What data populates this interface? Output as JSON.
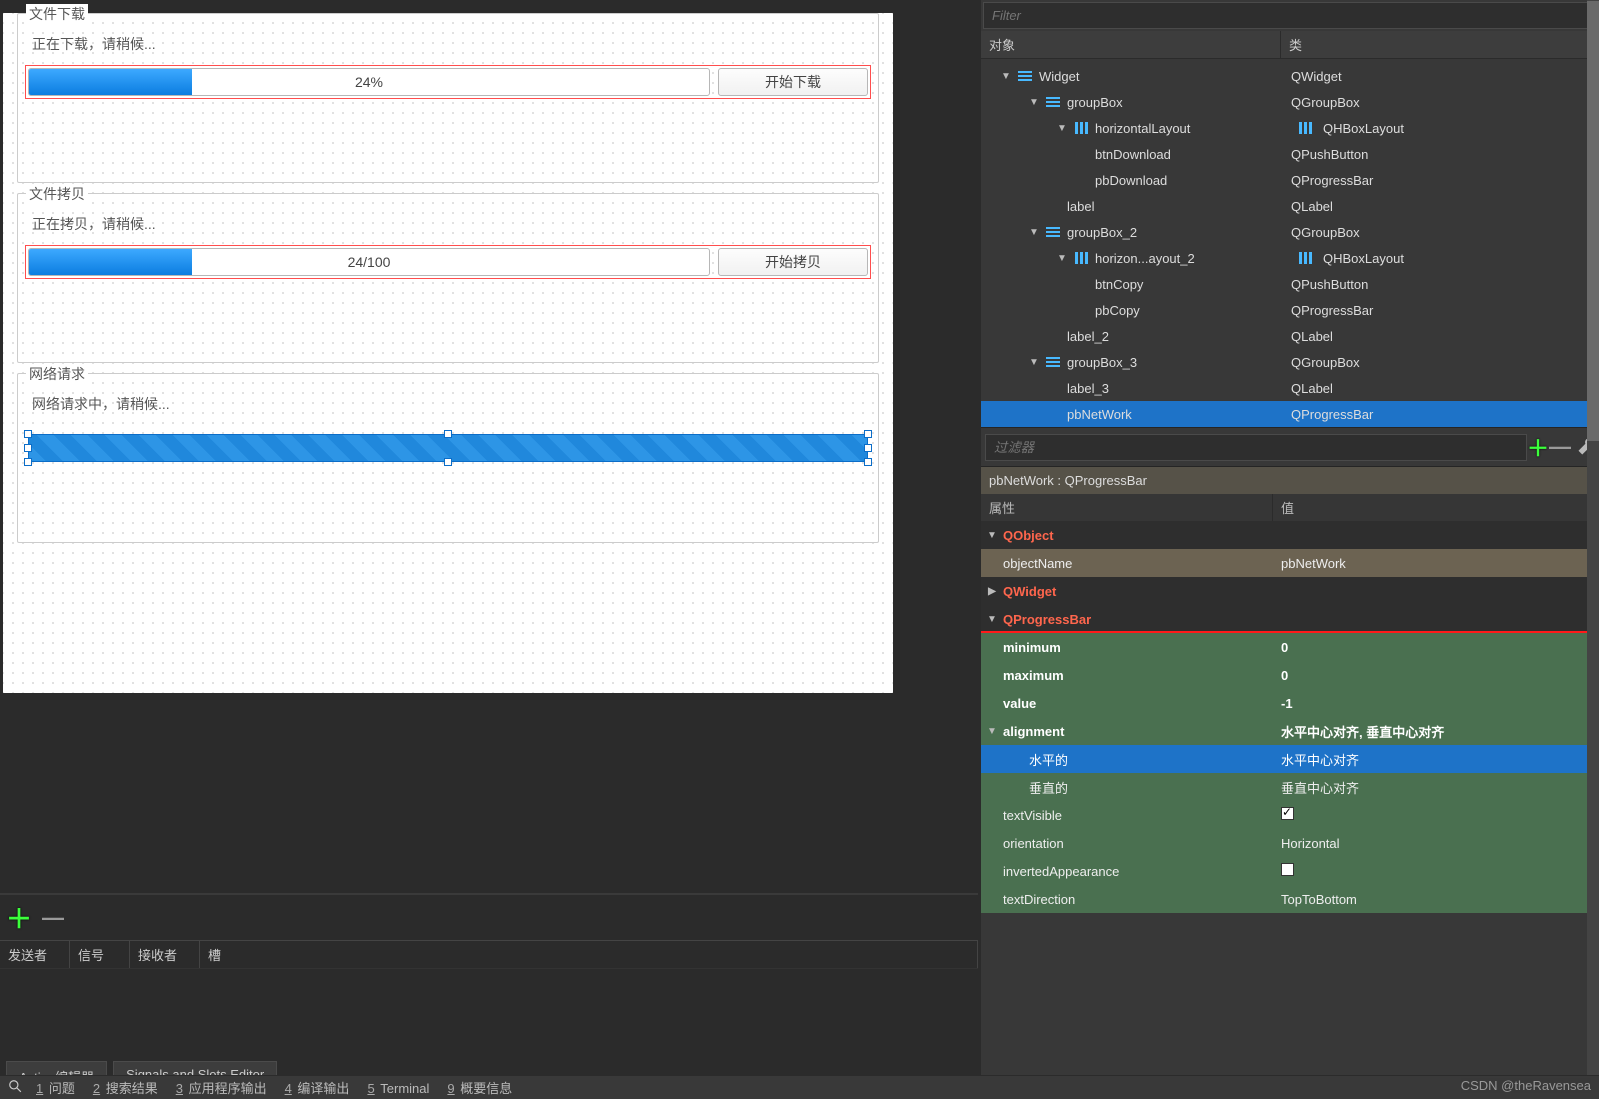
{
  "designer": {
    "group1": {
      "title": "文件下载",
      "label": "正在下载，请稍候...",
      "progress_text": "24%",
      "progress_percent": 24,
      "button": "开始下载"
    },
    "group2": {
      "title": "文件拷贝",
      "label": "正在拷贝，请稍候...",
      "progress_text": "24/100",
      "progress_percent": 24,
      "button": "开始拷贝"
    },
    "group3": {
      "title": "网络请求",
      "label": "网络请求中，请稍候..."
    }
  },
  "sig_panel": {
    "headers": {
      "sender": "发送者",
      "signal": "信号",
      "receiver": "接收者",
      "slot": "槽"
    },
    "tabs": {
      "action": "Action编辑器",
      "signals": "Signals and Slots Editor"
    }
  },
  "statusbar": {
    "items": [
      {
        "n": "1",
        "t": "问题"
      },
      {
        "n": "2",
        "t": "搜索结果"
      },
      {
        "n": "3",
        "t": "应用程序输出"
      },
      {
        "n": "4",
        "t": "编译输出"
      },
      {
        "n": "5",
        "t": "Terminal"
      },
      {
        "n": "9",
        "t": "概要信息"
      }
    ]
  },
  "watermark": "CSDN @theRavensea",
  "inspector": {
    "filter_placeholder": "Filter",
    "headers": {
      "object": "对象",
      "class": "类"
    },
    "tree": [
      {
        "d": 0,
        "exp": "▼",
        "icon": "form",
        "name": "Widget",
        "cls": "QWidget"
      },
      {
        "d": 1,
        "exp": "▼",
        "icon": "form",
        "name": "groupBox",
        "cls": "QGroupBox"
      },
      {
        "d": 2,
        "exp": "▼",
        "icon": "hbox",
        "name": "horizontalLayout",
        "cls": "QHBoxLayout",
        "clsicon": "hbox"
      },
      {
        "d": 3,
        "exp": "",
        "icon": "",
        "name": "btnDownload",
        "cls": "QPushButton"
      },
      {
        "d": 3,
        "exp": "",
        "icon": "",
        "name": "pbDownload",
        "cls": "QProgressBar"
      },
      {
        "d": 2,
        "exp": "",
        "icon": "",
        "name": "label",
        "cls": "QLabel"
      },
      {
        "d": 1,
        "exp": "▼",
        "icon": "form",
        "name": "groupBox_2",
        "cls": "QGroupBox"
      },
      {
        "d": 2,
        "exp": "▼",
        "icon": "hbox",
        "name": "horizon...ayout_2",
        "cls": "QHBoxLayout",
        "clsicon": "hbox"
      },
      {
        "d": 3,
        "exp": "",
        "icon": "",
        "name": "btnCopy",
        "cls": "QPushButton"
      },
      {
        "d": 3,
        "exp": "",
        "icon": "",
        "name": "pbCopy",
        "cls": "QProgressBar"
      },
      {
        "d": 2,
        "exp": "",
        "icon": "",
        "name": "label_2",
        "cls": "QLabel"
      },
      {
        "d": 1,
        "exp": "▼",
        "icon": "form",
        "name": "groupBox_3",
        "cls": "QGroupBox"
      },
      {
        "d": 2,
        "exp": "",
        "icon": "",
        "name": "label_3",
        "cls": "QLabel"
      },
      {
        "d": 2,
        "exp": "",
        "icon": "",
        "name": "pbNetWork",
        "cls": "QProgressBar",
        "sel": true
      }
    ],
    "prop_filter_placeholder": "过滤器",
    "prop_title": "pbNetWork : QProgressBar",
    "prop_headers": {
      "name": "属性",
      "value": "值"
    },
    "classes": {
      "qobject": "QObject",
      "qwidget": "QWidget",
      "qprogressbar": "QProgressBar"
    },
    "props": {
      "objectName": {
        "n": "objectName",
        "v": "pbNetWork"
      },
      "minimum": {
        "n": "minimum",
        "v": "0"
      },
      "maximum": {
        "n": "maximum",
        "v": "0"
      },
      "value": {
        "n": "value",
        "v": "-1"
      },
      "alignment": {
        "n": "alignment",
        "v": "水平中心对齐, 垂直中心对齐"
      },
      "align_h": {
        "n": "水平的",
        "v": "水平中心对齐"
      },
      "align_v": {
        "n": "垂直的",
        "v": "垂直中心对齐"
      },
      "textVisible": {
        "n": "textVisible",
        "v_checked": true
      },
      "orientation": {
        "n": "orientation",
        "v": "Horizontal"
      },
      "invertedAppearance": {
        "n": "invertedAppearance",
        "v_checked": false
      },
      "textDirection": {
        "n": "textDirection",
        "v": "TopToBottom"
      }
    }
  }
}
